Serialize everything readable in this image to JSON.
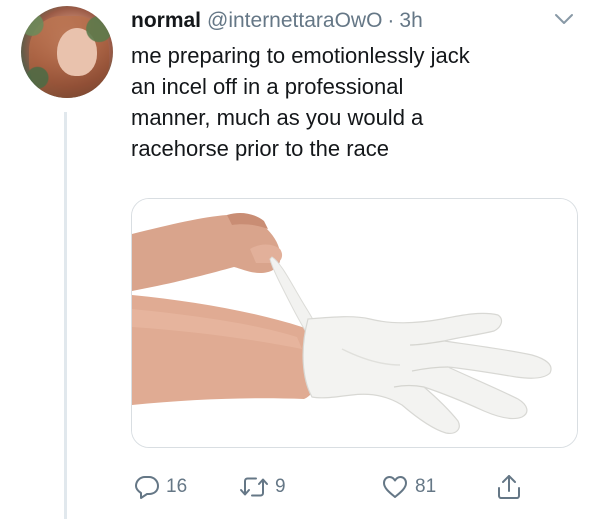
{
  "tweet": {
    "display_name": "normal",
    "handle": "@internettaraOwO",
    "separator": "·",
    "time": "3h",
    "text_lines": [
      "me preparing to emotionlessly jack",
      "an incel off in a professional",
      "manner, much as you would a",
      "racehorse prior to the race"
    ],
    "media_alt": "photo of a hand pulling on a white latex glove"
  },
  "actions": {
    "replies": "16",
    "retweets": "9",
    "likes": "81"
  },
  "icons": {
    "reply": "speech-bubble-icon",
    "retweet": "retweet-arrows-icon",
    "like": "heart-icon",
    "share": "share-upload-icon",
    "menu": "chevron-down-icon"
  },
  "colors": {
    "text": "#14171a",
    "secondary": "#657786",
    "border": "#d9dee2",
    "thread_line": "#e1e8ed"
  }
}
